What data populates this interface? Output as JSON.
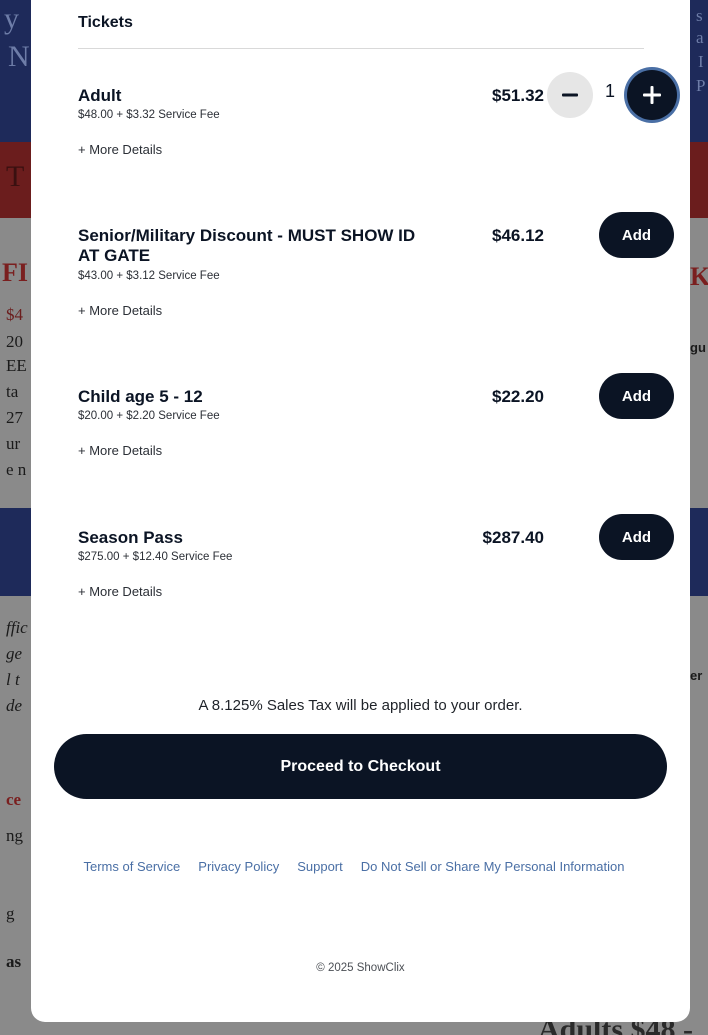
{
  "tickets_heading": "Tickets",
  "tickets": [
    {
      "name": "Adult",
      "fee": "$48.00 + $3.32 Service Fee",
      "more": "+ More Details",
      "price": "$51.32",
      "quantity": "1"
    },
    {
      "name": "Senior/Military Discount - MUST SHOW ID AT GATE",
      "fee": "$43.00 + $3.12 Service Fee",
      "more": "+ More Details",
      "price": "$46.12",
      "add_label": "Add"
    },
    {
      "name": "Child age 5 - 12",
      "fee": "$20.00 + $2.20 Service Fee",
      "more": "+ More Details",
      "price": "$22.20",
      "add_label": "Add"
    },
    {
      "name": "Season Pass",
      "fee": "$275.00 + $12.40 Service Fee",
      "more": "+ More Details",
      "price": "$287.40",
      "add_label": "Add"
    }
  ],
  "tax_note": "A 8.125% Sales Tax will be applied to your order.",
  "checkout_label": "Proceed to Checkout",
  "footer_links": [
    "Terms of Service",
    "Privacy Policy",
    "Support",
    "Do Not Sell or Share My Personal Information"
  ],
  "copyright": "© 2025 ShowClix",
  "icons": {
    "minus": "minus-icon",
    "plus": "plus-icon"
  },
  "colors": {
    "primary": "#0b1424",
    "link": "#4a6fa5",
    "focus_ring": "#4a6fa5"
  },
  "background_fragments": [
    "y",
    "N",
    "T",
    "FI",
    "$4",
    "20",
    "EE",
    "ta",
    "27",
    "ur",
    "e n",
    "ffic",
    "ge",
    "l t",
    "de",
    "ce",
    "ng",
    "g",
    "as",
    "s",
    "a",
    "I",
    "P",
    "K",
    "gu",
    "er",
    "Adults $48 -"
  ]
}
